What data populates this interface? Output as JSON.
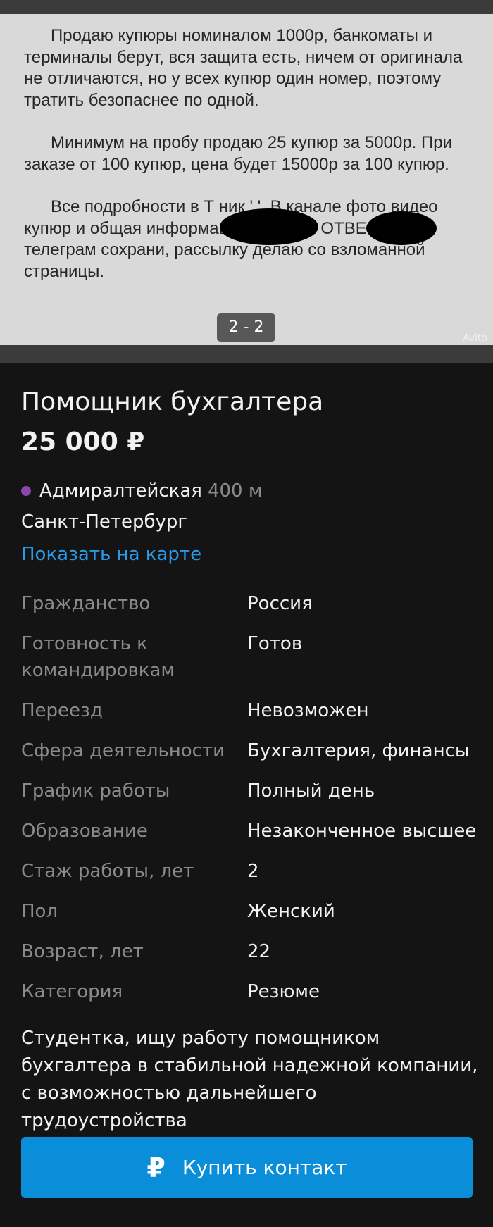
{
  "photo": {
    "text_paragraphs": [
      "Продаю купюры номиналом 1000р, банкоматы и терминалы берут, вся защита есть, ничем от оригинала не отличаются, но у всех купюр один номер, поэтому тратить безопаснее по одной.",
      "Минимум на пробу продаю 25 купюр за 5000р. При заказе от 100 купюр, цена будет 15000р за 100 купюр.",
      "Все подробности в Т            ник '           '. В канале фото видео купюр и общая информация. ТУТ НЕ ОТВЕЧАЙ, телеграм сохрани, рассылку делаю со взломанной страницы."
    ],
    "counter": "2 - 2",
    "watermark": "Avito"
  },
  "listing": {
    "title": "Помощник бухгалтера",
    "price": "25 000 ₽",
    "metro_station": "Адмиралтейская",
    "metro_distance": "400 м",
    "metro_color": "#8e44ad",
    "city": "Санкт-Петербург",
    "map_link": "Показать на карте"
  },
  "params": [
    {
      "k": "Гражданство",
      "v": "Россия"
    },
    {
      "k": "Готовность к командировкам",
      "v": "Готов"
    },
    {
      "k": "Переезд",
      "v": "Невозможен"
    },
    {
      "k": "Сфера деятельности",
      "v": "Бухгалтерия, финансы"
    },
    {
      "k": "График работы",
      "v": "Полный день"
    },
    {
      "k": "Образование",
      "v": "Незаконченное высшее"
    },
    {
      "k": "Стаж работы, лет",
      "v": "2"
    },
    {
      "k": "Пол",
      "v": "Женский"
    },
    {
      "k": "Возраст, лет",
      "v": "22"
    },
    {
      "k": "Категория",
      "v": "Резюме"
    }
  ],
  "description": "Студентка, ищу работу помощником бухгалтера в стабильной надежной компании, с возможностью дальнейшего трудоустройства",
  "buy_button": {
    "icon": "ruble-icon",
    "label": "Купить контакт",
    "color": "#0a8ed9"
  }
}
